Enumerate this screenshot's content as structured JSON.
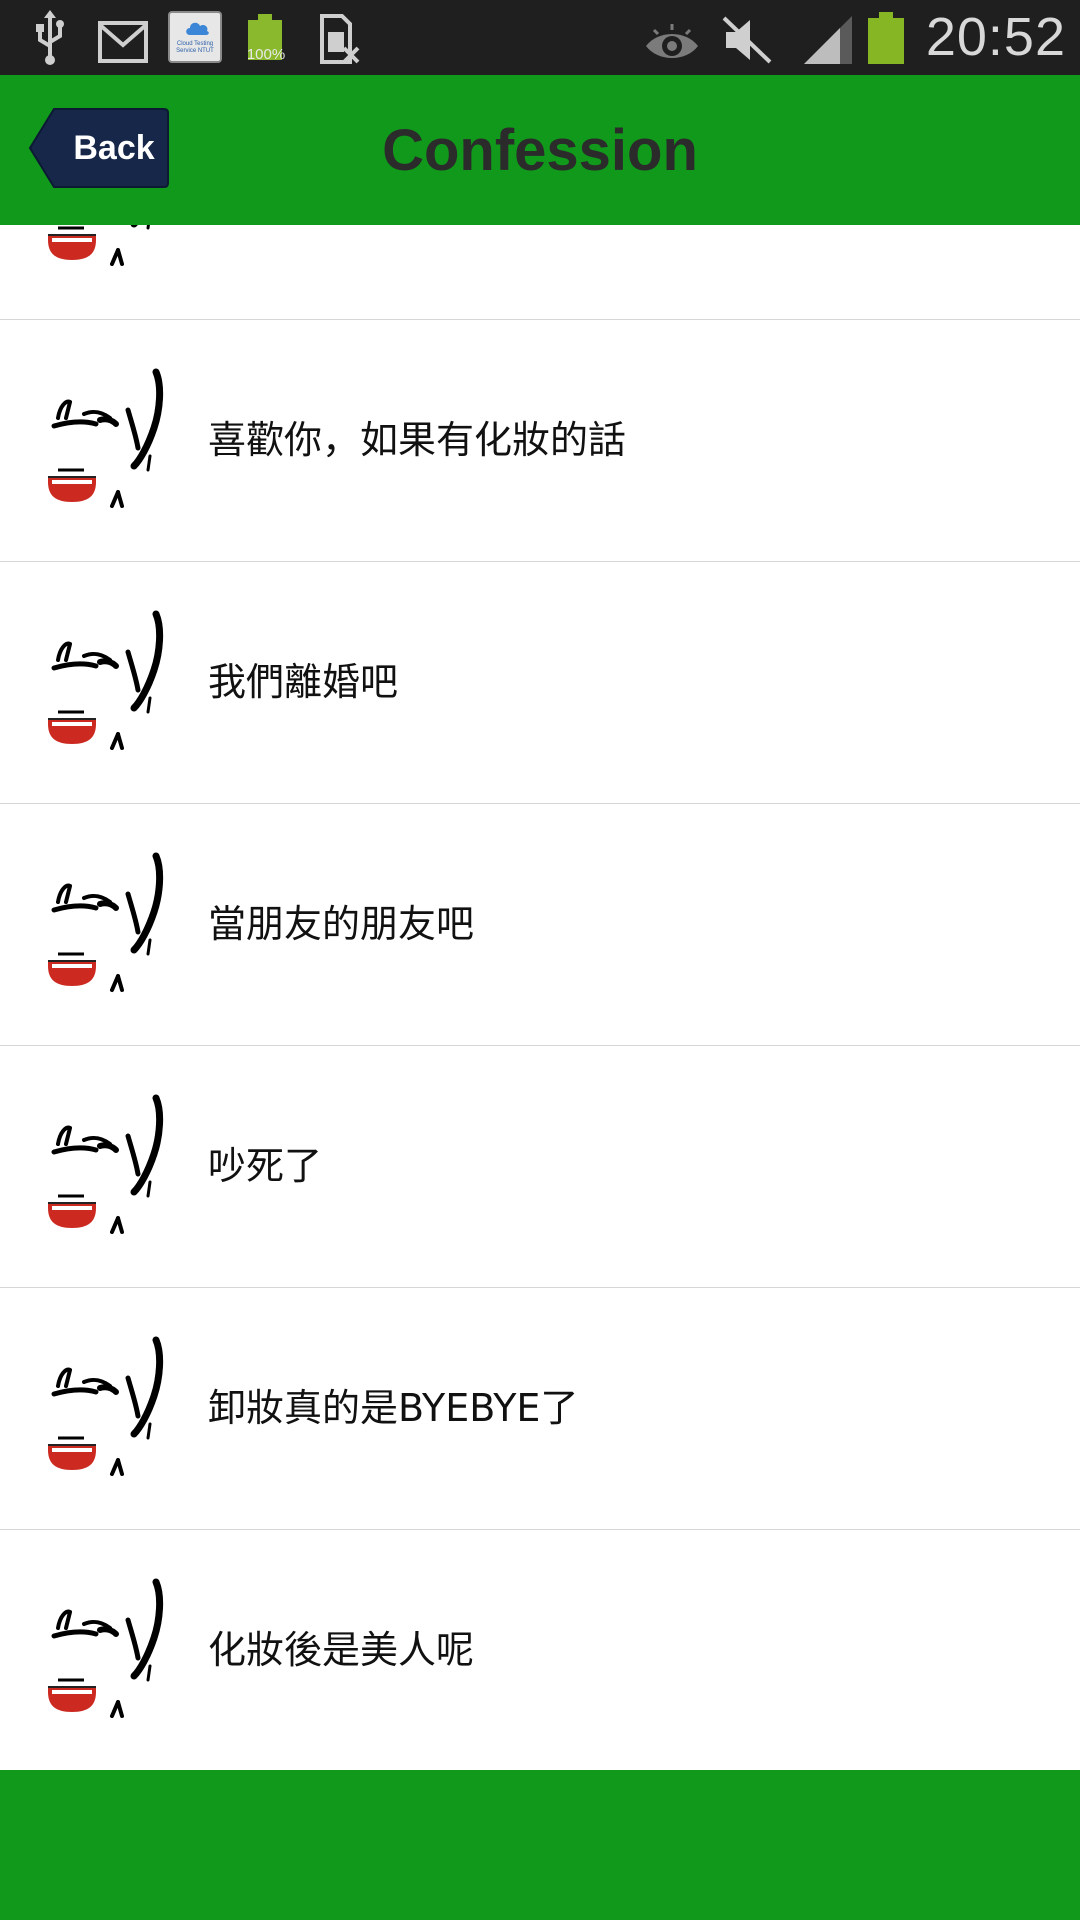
{
  "status_bar": {
    "time": "20:52",
    "battery_notification_text": "100%",
    "cloud_app_text": "Cloud Testing Service NTUT",
    "icons": [
      "usb-icon",
      "gmail-icon",
      "cloud-testing-icon",
      "battery-notification-icon",
      "sim-error-icon",
      "eye-icon",
      "vibrate-off-icon",
      "signal-icon",
      "battery-icon"
    ]
  },
  "header": {
    "back_label": "Back",
    "title": "Confession"
  },
  "list": {
    "items": [
      {
        "label": ""
      },
      {
        "label": "喜歡你，如果有化妝的話"
      },
      {
        "label": "我們離婚吧"
      },
      {
        "label": "當朋友的朋友吧"
      },
      {
        "label": "吵死了"
      },
      {
        "label": "卸妝真的是BYEBYE了"
      },
      {
        "label": "化妝後是美人呢"
      }
    ]
  },
  "colors": {
    "accent_green": "#10991a",
    "status_bar": "#1f1f1f",
    "back_button": "#16274a",
    "battery_green": "#86b623"
  }
}
